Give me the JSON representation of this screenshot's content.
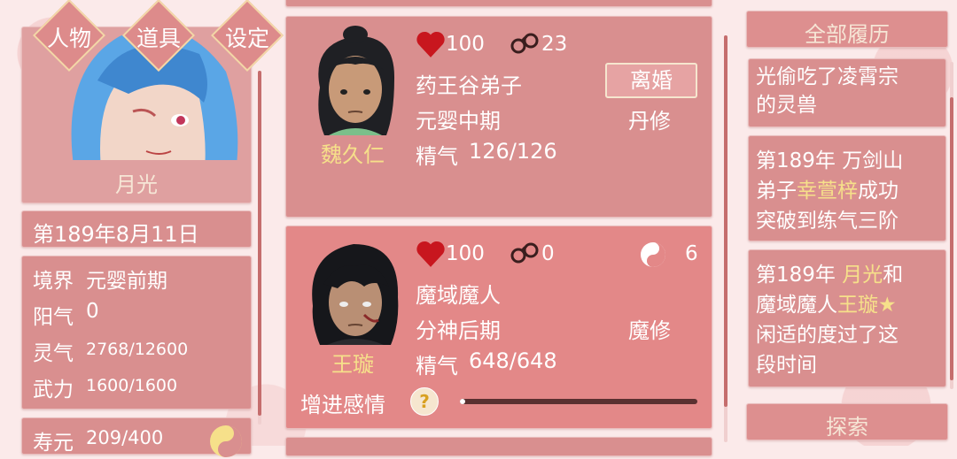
{
  "nav": {
    "characters": "人物",
    "items": "道具",
    "settings": "设定"
  },
  "player": {
    "name": "月光",
    "date": "第189年8月11日",
    "realm_label": "境界",
    "realm_value": "元婴前期",
    "yang_label": "阳气",
    "yang_value": "0",
    "spirit_label": "灵气",
    "spirit_value": "2768/12600",
    "force_label": "武力",
    "force_value": "1600/1600",
    "lifespan_label": "寿元",
    "lifespan_value": "209/400"
  },
  "cards": [
    {
      "name": "魏久仁",
      "hp": "100",
      "bond": "23",
      "identity": "药王谷弟子",
      "stage": "元婴中期",
      "path": "丹修",
      "essence_label": "精气",
      "essence_value": "126/126",
      "action": "离婚"
    },
    {
      "name": "王璇",
      "hp": "100",
      "bond": "0",
      "yin_yang": "6",
      "identity": "魔域魔人",
      "stage": "分神后期",
      "path": "魔修",
      "essence_label": "精气",
      "essence_value": "648/648",
      "affection_label": "增进感情",
      "help": "?",
      "affection_progress": 0.02
    }
  ],
  "history": {
    "title": "全部履历",
    "entry1": [
      "光偷吃了凌霄宗",
      "的灵兽"
    ],
    "entry2": {
      "line1": "第189年 万剑山",
      "line2_pre": "弟子",
      "line2_name": "幸萱梓",
      "line2_post": "成功",
      "line3": "突破到练气三阶"
    },
    "entry3": {
      "line1_pre": "第189年 ",
      "line1_name": "月光",
      "line1_post": "和",
      "line2_pre": "魔域魔人",
      "line2_name": "王璇★",
      "line3": "闲适的度过了这",
      "line4": "段时间"
    },
    "explore": "探索"
  },
  "colors": {
    "panel": "#d98f8f",
    "panel_active": "#e38888",
    "gold_text": "#f6e08a",
    "heart": "#c8161e",
    "background": "#fbeaea"
  }
}
